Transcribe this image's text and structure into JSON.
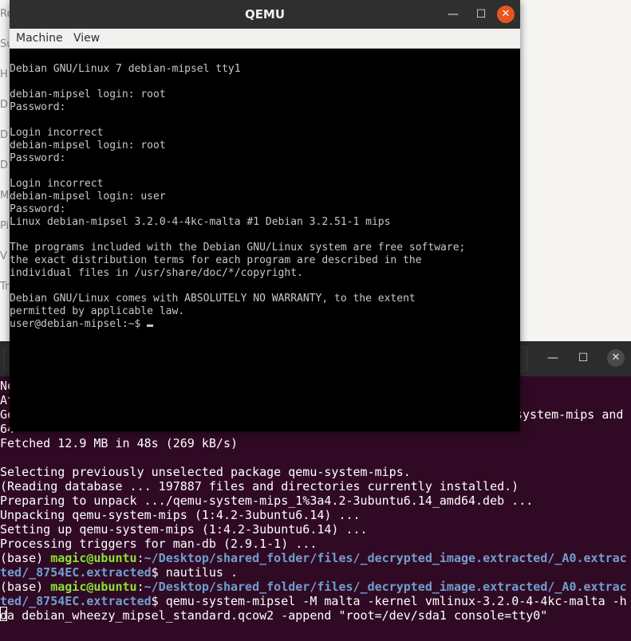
{
  "background_app": {
    "sidebar_items": [
      "Re",
      "Su",
      "H",
      "D",
      "D",
      "D",
      "M",
      "Pi",
      "V",
      "Tr"
    ]
  },
  "terminal": {
    "controls": {
      "minimize": "—",
      "maximize": "☐",
      "close": "✕"
    },
    "lines": [
      {
        "text": "Ne"
      },
      {
        "text": "At"
      },
      {
        "text": "Ge",
        "right": "system-mips and"
      },
      {
        "text": "64"
      },
      {
        "text": "Fetched 12.9 MB in 48s (269 kB/s)"
      },
      {
        "text": ""
      },
      {
        "text": "Selecting previously unselected package qemu-system-mips."
      },
      {
        "text": "(Reading database ... 197887 files and directories currently installed.)"
      },
      {
        "text": "Preparing to unpack .../qemu-system-mips_1%3a4.2-3ubuntu6.14_amd64.deb ..."
      },
      {
        "text": "Unpacking qemu-system-mips (1:4.2-3ubuntu6.14) ..."
      },
      {
        "text": "Setting up qemu-system-mips (1:4.2-3ubuntu6.14) ..."
      },
      {
        "text": "Processing triggers for man-db (2.9.1-1) ..."
      }
    ],
    "prompt": {
      "env": "(base) ",
      "user_host": "magic@ubuntu",
      "sep": ":",
      "path_line1": "~/Desktop/shared_folder/files/_decrypted_image.extracted/_A0.extrac",
      "path_line2": "ted/_8754EC.extracted",
      "dollar": "$ "
    },
    "commands": [
      {
        "cmd_line1": "nautilus ."
      },
      {
        "cmd_line1": "qemu-system-mipsel -M malta -kernel vmlinux-3.2.0-4-4kc-malta -h",
        "cmd_line2": "da debian_wheezy_mipsel_standard.qcow2 -append \"root=/dev/sda1 console=tty0\""
      }
    ]
  },
  "qemu": {
    "title": "QEMU",
    "controls": {
      "minimize": "—",
      "maximize": "☐",
      "close": "✕"
    },
    "menu": {
      "machine": "Machine",
      "view": "View"
    },
    "console_lines": [
      "",
      "Debian GNU/Linux 7 debian-mipsel tty1",
      "",
      "debian-mipsel login: root",
      "Password:",
      "",
      "Login incorrect",
      "debian-mipsel login: root",
      "Password:",
      "",
      "Login incorrect",
      "debian-mipsel login: user",
      "Password:",
      "Linux debian-mipsel 3.2.0-4-4kc-malta #1 Debian 3.2.51-1 mips",
      "",
      "The programs included with the Debian GNU/Linux system are free software;",
      "the exact distribution terms for each program are described in the",
      "individual files in /usr/share/doc/*/copyright.",
      "",
      "Debian GNU/Linux comes with ABSOLUTELY NO WARRANTY, to the extent",
      "permitted by applicable law.",
      "user@debian-mipsel:~$ "
    ]
  },
  "colors": {
    "terminal_bg": "#300a24",
    "prompt_user": "#8ae234",
    "prompt_path": "#729fcf",
    "close_accent": "#e95420",
    "qemu_console_fg": "#c8c8c8"
  }
}
